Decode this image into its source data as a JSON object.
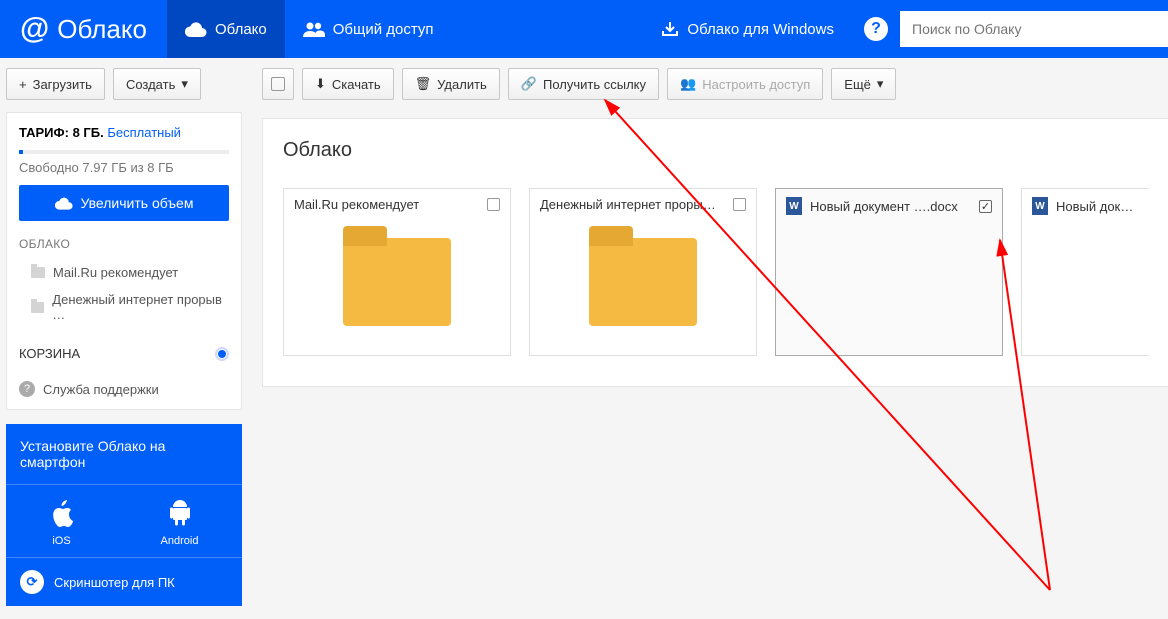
{
  "header": {
    "brand": "Облако",
    "nav_cloud": "Облако",
    "nav_shared": "Общий доступ",
    "nav_windows": "Облако для Windows",
    "search_placeholder": "Поиск по Облаку"
  },
  "sidebar": {
    "upload": "Загрузить",
    "create": "Создать",
    "tariff_label": "ТАРИФ:",
    "tariff_size": "8 ГБ.",
    "tariff_plan": "Бесплатный",
    "quota": "Свободно 7.97 ГБ из 8 ГБ",
    "increase": "Увеличить объем",
    "section_cloud": "ОБЛАКО",
    "folders": [
      "Mail.Ru рекомендует",
      "Денежный интернет прорыв …"
    ],
    "trash": "КОРЗИНА",
    "support": "Служба поддержки",
    "promo_title": "Установите Облако на смартфон",
    "promo_ios": "iOS",
    "promo_android": "Android",
    "promo_screenshoter": "Скриншотер для ПК"
  },
  "toolbar": {
    "download": "Скачать",
    "delete": "Удалить",
    "get_link": "Получить ссылку",
    "configure_access": "Настроить доступ",
    "more": "Ещё"
  },
  "main": {
    "breadcrumb": "Облако",
    "files": [
      {
        "name": "Mail.Ru рекомендует",
        "type": "folder",
        "checked": false
      },
      {
        "name": "Денежный интернет проры…",
        "type": "folder",
        "checked": false
      },
      {
        "name": "Новый документ ….docx",
        "type": "doc",
        "checked": true
      },
      {
        "name": "Новый докумен",
        "type": "doc",
        "checked": false,
        "cutoff": true
      }
    ]
  }
}
